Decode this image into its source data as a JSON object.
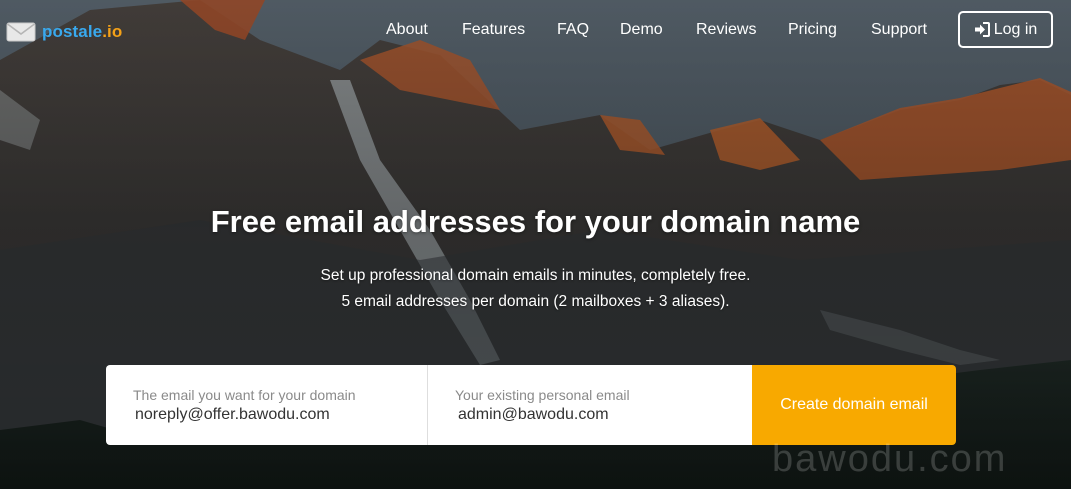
{
  "brand": {
    "name": "postale",
    "tld": ".io",
    "name_color": "#39a9ee",
    "tld_color": "#f4a118",
    "icon": "envelope-icon"
  },
  "nav": {
    "items": [
      "About",
      "Features",
      "FAQ",
      "Demo",
      "Reviews",
      "Pricing",
      "Support"
    ],
    "login_label": "Log in",
    "login_icon": "sign-in-icon"
  },
  "hero": {
    "title": "Free email addresses for your domain name",
    "subtitle_line1": "Set up professional domain emails in minutes, completely free.",
    "subtitle_line2": "5 email addresses per domain (2 mailboxes + 3 aliases)."
  },
  "form": {
    "domain_email_label": "The email you want for your domain",
    "domain_email_value": "noreply@offer.bawodu.com",
    "personal_email_label": "Your existing personal email",
    "personal_email_value": "admin@bawodu.com",
    "submit_label": "Create domain email",
    "submit_color": "#f8a900"
  },
  "watermark": "bawodu.com"
}
